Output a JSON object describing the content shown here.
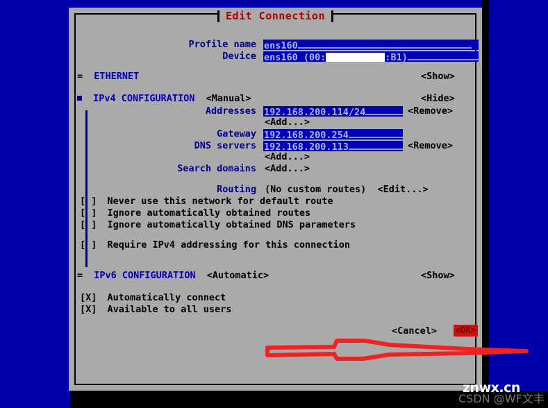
{
  "window": {
    "title": "Edit Connection",
    "background_color": "#0000aa",
    "dialog_color": "#aaaaaa",
    "title_color": "#aa0000"
  },
  "fields": {
    "profile_name_label": "Profile name",
    "profile_name_value": "ens160",
    "device_label": "Device",
    "device_value_prefix": "ens160 (00:",
    "device_value_redacted": "            ",
    "device_value_suffix": ":B1)"
  },
  "ethernet": {
    "marker": "=",
    "label": "ETHERNET",
    "action": "<Show>"
  },
  "ipv4": {
    "label": "IPv4 CONFIGURATION",
    "mode": "<Manual>",
    "action": "<Hide>",
    "addresses_label": "Addresses",
    "addresses_value": "192.168.200.114/24",
    "addresses_remove": "<Remove>",
    "addresses_add": "<Add...>",
    "gateway_label": "Gateway",
    "gateway_value": "192.168.200.254",
    "dns_label": "DNS servers",
    "dns_value": "192.168.200.113",
    "dns_remove": "<Remove>",
    "dns_add": "<Add...>",
    "search_domains_label": "Search domains",
    "search_domains_add": "<Add...>",
    "routing_label": "Routing",
    "routing_value": "(No custom routes)",
    "routing_edit": "<Edit...>",
    "checkboxes": [
      {
        "state": "[ ]",
        "label": "Never use this network for default route"
      },
      {
        "state": "[ ]",
        "label": "Ignore automatically obtained routes"
      },
      {
        "state": "[ ]",
        "label": "Ignore automatically obtained DNS parameters"
      },
      {
        "state": "[ ]",
        "label": "Require IPv4 addressing for this connection"
      }
    ]
  },
  "ipv6": {
    "marker": "=",
    "label": "IPv6 CONFIGURATION",
    "mode": "<Automatic>",
    "action": "<Show>"
  },
  "global_options": [
    {
      "state": "[X]",
      "label": "Automatically connect"
    },
    {
      "state": "[X]",
      "label": "Available to all users"
    }
  ],
  "buttons": {
    "cancel": "<Cancel>",
    "ok": "<OK>",
    "ok_color": "#cc1111"
  },
  "annotation": {
    "type": "red-arrow",
    "color": "#ee2222",
    "points_to": "<OK>"
  },
  "watermark": {
    "main": "znwx.cn",
    "sub": "CSDN @WF文丰"
  }
}
